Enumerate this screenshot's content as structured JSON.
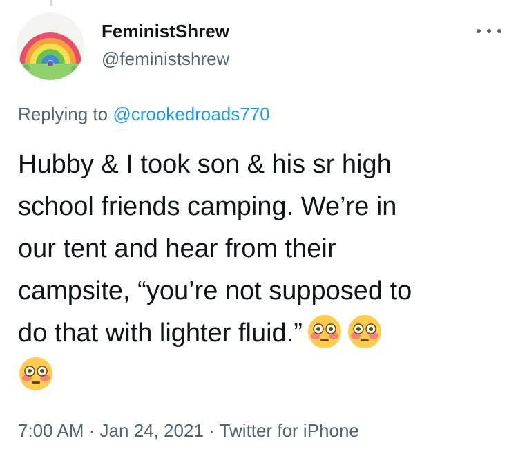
{
  "author": {
    "display_name": "FeministShrew",
    "handle": "@feministshrew",
    "avatar": "rainbow-painting-avatar"
  },
  "more_icon": "more-horizontal-icon",
  "reply_context": {
    "prefix": "Replying to",
    "handle": "@crookedroads770"
  },
  "tweet": {
    "lines": [
      "Hubby & I took son & his sr high",
      "school friends camping. We’re in",
      "our tent and hear from their",
      "campsite, “you’re not supposed to",
      "do that with lighter fluid.”"
    ],
    "emojis": [
      "flushed-face-emoji",
      "flushed-face-emoji",
      "flushed-face-emoji"
    ]
  },
  "meta": {
    "time": "7:00 AM",
    "separator": "·",
    "date": "Jan 24, 2021",
    "source": "Twitter for iPhone"
  },
  "colors": {
    "text": "#0f1419",
    "secondary": "#536471",
    "link": "#1d9bf0"
  }
}
